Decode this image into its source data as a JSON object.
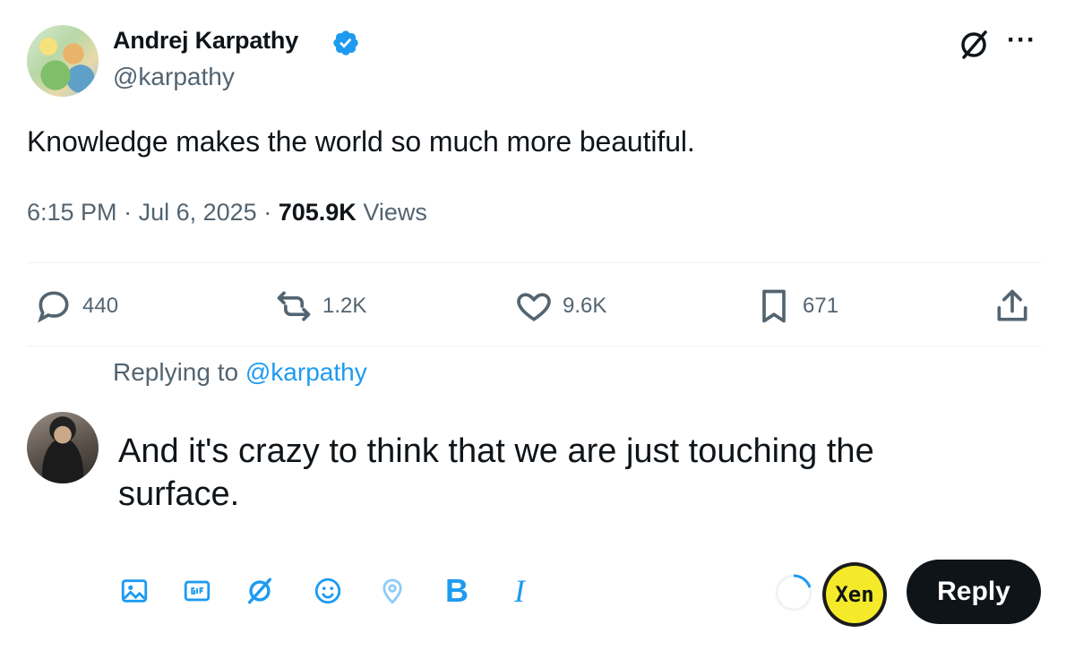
{
  "tweet": {
    "author_name": "Andrej Karpathy",
    "author_handle": "@karpathy",
    "text": "Knowledge makes the world so much more beautiful.",
    "time": "6:15 PM",
    "date": "Jul 6, 2025",
    "views_count": "705.9K",
    "views_label": "Views",
    "separator": "·",
    "more_label": "···"
  },
  "actions": {
    "replies": "440",
    "reposts": "1.2K",
    "likes": "9.6K",
    "bookmarks": "671"
  },
  "reply_composer": {
    "replying_prefix": "Replying to",
    "replying_handle": "@karpathy",
    "draft_text": "And it's crazy to think that we are just touching the surface.",
    "bold_label": "B",
    "italic_label": "I",
    "extension_badge": "Xen",
    "submit_label": "Reply"
  },
  "icons": [
    "verified-badge-icon",
    "grok-icon",
    "more-icon",
    "reply-icon",
    "repost-icon",
    "like-icon",
    "bookmark-icon",
    "share-icon",
    "media-icon",
    "gif-icon",
    "grok-icon",
    "emoji-icon",
    "location-icon"
  ],
  "colors": {
    "accent": "#1d9bf0",
    "text_primary": "#0f1419",
    "text_secondary": "#536471",
    "reply_button_bg": "#0f1419",
    "xen_badge": "#f4ea2a"
  }
}
